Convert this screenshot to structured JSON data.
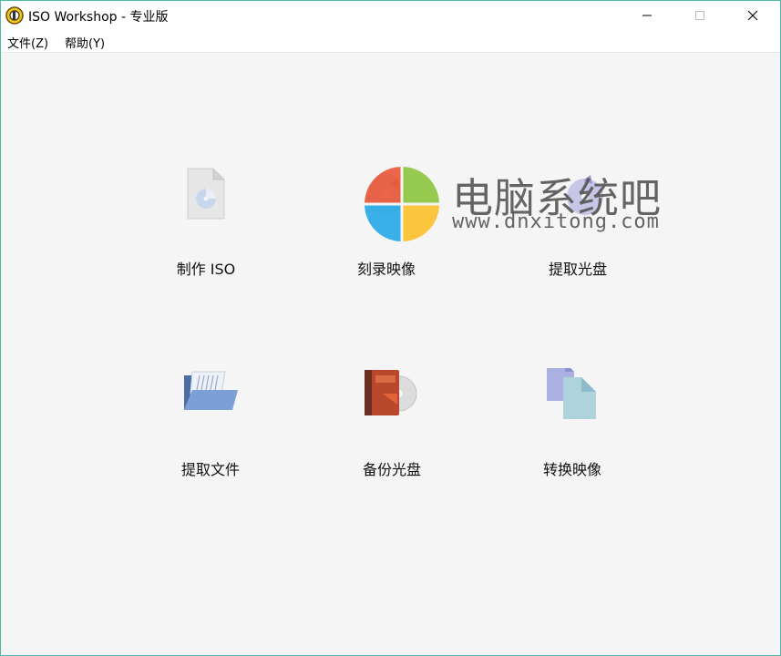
{
  "window": {
    "title": "ISO Workshop - 专业版",
    "controls": [
      "minimize-icon",
      "maximize-icon",
      "close-icon"
    ]
  },
  "menu": {
    "file": "文件(Z)",
    "help": "帮助(Y)"
  },
  "tools": {
    "make_iso": "制作 ISO",
    "burn_image": "刻录映像",
    "extract_disc": "提取光盘",
    "extract_files": "提取文件",
    "backup_disc": "备份光盘",
    "convert_image": "转换映像"
  },
  "watermark": {
    "text": "电脑系统吧",
    "url": "www.dnxitong.com"
  },
  "colors": {
    "border": "#4fb8a8",
    "background": "#f5f5f5",
    "titlebar": "#ffffff"
  }
}
